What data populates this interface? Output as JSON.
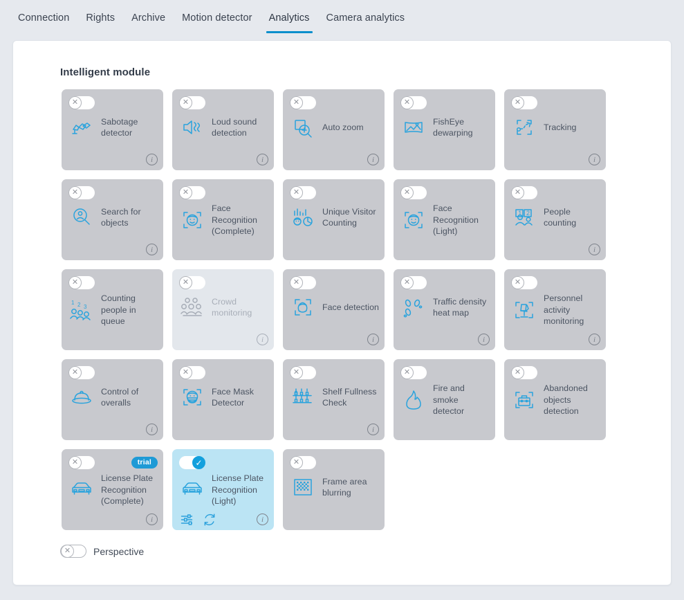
{
  "tabs": [
    {
      "label": "Connection",
      "active": false
    },
    {
      "label": "Rights",
      "active": false
    },
    {
      "label": "Archive",
      "active": false
    },
    {
      "label": "Motion detector",
      "active": false
    },
    {
      "label": "Analytics",
      "active": true
    },
    {
      "label": "Camera analytics",
      "active": false
    }
  ],
  "accent_color": "#0a8fcc",
  "section": {
    "title": "Intelligent module"
  },
  "modules": [
    {
      "label": "Sabotage detector",
      "icon": "sabotage-icon",
      "state": "off",
      "info": true,
      "disabled": false,
      "trial": null
    },
    {
      "label": "Loud sound detection",
      "icon": "loud-sound-icon",
      "state": "off",
      "info": true,
      "disabled": false,
      "trial": null
    },
    {
      "label": "Auto zoom",
      "icon": "auto-zoom-icon",
      "state": "off",
      "info": true,
      "disabled": false,
      "trial": null
    },
    {
      "label": "FishEye dewarping",
      "icon": "fisheye-dewarping-icon",
      "state": "off",
      "info": false,
      "disabled": false,
      "trial": null
    },
    {
      "label": "Tracking",
      "icon": "tracking-icon",
      "state": "off",
      "info": true,
      "disabled": false,
      "trial": null
    },
    {
      "label": "Search for objects",
      "icon": "search-objects-icon",
      "state": "off",
      "info": true,
      "disabled": false,
      "trial": null
    },
    {
      "label": "Face Recognition (Complete)",
      "icon": "face-recognition-icon",
      "state": "off",
      "info": false,
      "disabled": false,
      "trial": null
    },
    {
      "label": "Unique Visitor Counting",
      "icon": "unique-visitor-counting-icon",
      "state": "off",
      "info": false,
      "disabled": false,
      "trial": null
    },
    {
      "label": "Face Recognition (Light)",
      "icon": "face-recognition-icon",
      "state": "off",
      "info": false,
      "disabled": false,
      "trial": null
    },
    {
      "label": "People counting",
      "icon": "people-counting-icon",
      "state": "off",
      "info": true,
      "disabled": false,
      "trial": null
    },
    {
      "label": "Counting people in queue",
      "icon": "queue-counting-icon",
      "state": "off",
      "info": false,
      "disabled": false,
      "trial": null
    },
    {
      "label": "Crowd monitoring",
      "icon": "crowd-monitoring-icon",
      "state": "off",
      "info": true,
      "disabled": true,
      "trial": null
    },
    {
      "label": "Face detection",
      "icon": "face-detection-icon",
      "state": "off",
      "info": true,
      "disabled": false,
      "trial": null
    },
    {
      "label": "Traffic density heat map",
      "icon": "traffic-heatmap-icon",
      "state": "off",
      "info": true,
      "disabled": false,
      "trial": null
    },
    {
      "label": "Personnel activity monitoring",
      "icon": "personnel-activity-icon",
      "state": "off",
      "info": true,
      "disabled": false,
      "trial": null
    },
    {
      "label": "Control of overalls",
      "icon": "helmet-icon",
      "state": "off",
      "info": true,
      "disabled": false,
      "trial": null
    },
    {
      "label": "Face Mask Detector",
      "icon": "face-mask-icon",
      "state": "off",
      "info": false,
      "disabled": false,
      "trial": null
    },
    {
      "label": "Shelf Fullness Check",
      "icon": "shelf-fullness-icon",
      "state": "off",
      "info": true,
      "disabled": false,
      "trial": null
    },
    {
      "label": "Fire and smoke detector",
      "icon": "fire-smoke-icon",
      "state": "off",
      "info": false,
      "disabled": false,
      "trial": null
    },
    {
      "label": "Abandoned objects detection",
      "icon": "abandoned-objects-icon",
      "state": "off",
      "info": false,
      "disabled": false,
      "trial": null
    },
    {
      "label": "License Plate Recognition (Complete)",
      "icon": "license-plate-icon",
      "state": "off",
      "info": true,
      "disabled": false,
      "trial": "trial"
    },
    {
      "label": "License Plate Recognition (Light)",
      "icon": "license-plate-icon",
      "state": "on",
      "info": true,
      "disabled": false,
      "trial": null,
      "actions": [
        "settings-sliders-icon",
        "refresh-icon"
      ]
    },
    {
      "label": "Frame area blurring",
      "icon": "frame-blur-icon",
      "state": "off",
      "info": false,
      "disabled": false,
      "trial": null
    }
  ],
  "perspective": {
    "label": "Perspective",
    "state": "off"
  },
  "toggle_glyphs": {
    "off": "✕",
    "on": "✓"
  }
}
